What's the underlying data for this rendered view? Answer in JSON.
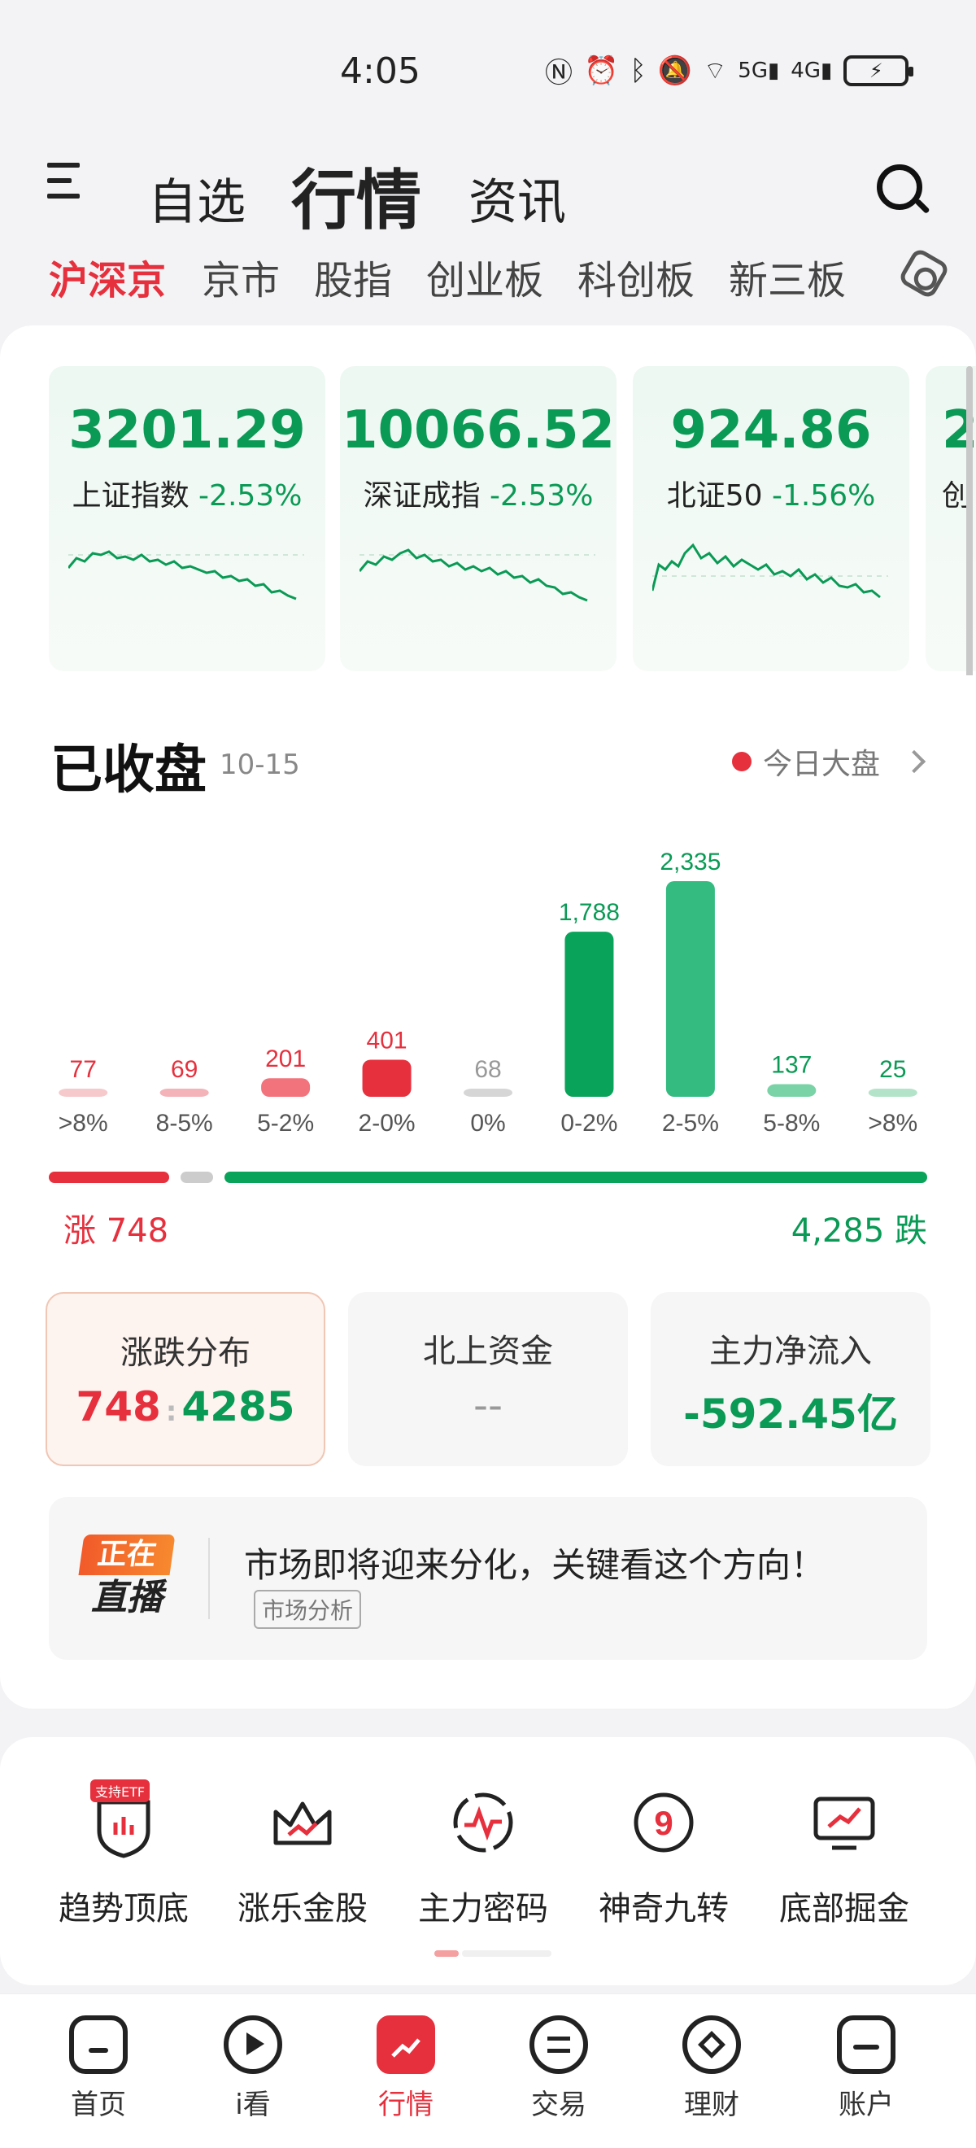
{
  "status_bar": {
    "time": "4:05",
    "icons": [
      "nfc-icon",
      "alarm-icon",
      "bluetooth-icon",
      "mute-icon",
      "wifi-icon",
      "5g-signal-icon",
      "4g-signal-icon",
      "battery-charging-icon"
    ]
  },
  "header": {
    "tabs": [
      "自选",
      "行情",
      "资讯"
    ],
    "active_tab": "行情"
  },
  "sub_tabs": [
    "沪深京",
    "京市",
    "股指",
    "创业板",
    "科创板",
    "新三板"
  ],
  "indices": [
    {
      "value": "3201.29",
      "name": "上证指数",
      "change": "-2.53%"
    },
    {
      "value": "10066.52",
      "name": "深证成指",
      "change": "-2.53%"
    },
    {
      "value": "924.86",
      "name": "北证50",
      "change": "-1.56%"
    },
    {
      "value": "2",
      "name": "创",
      "change": ""
    }
  ],
  "market": {
    "status": "已收盘",
    "date": "10-15",
    "today_link": "今日大盘"
  },
  "chart_data": {
    "type": "bar",
    "categories": [
      ">8%",
      "8-5%",
      "5-2%",
      "2-0%",
      "0%",
      "0-2%",
      "2-5%",
      "5-8%",
      ">8%"
    ],
    "values": [
      77,
      69,
      201,
      401,
      68,
      1788,
      2335,
      137,
      25
    ],
    "value_labels": [
      "77",
      "69",
      "201",
      "401",
      "68",
      "1,788",
      "2,335",
      "137",
      "25"
    ],
    "colors": [
      "#f6c9cc",
      "#f3b3b8",
      "#f2737c",
      "#e6303d",
      "#d6d6d6",
      "#0aa35a",
      "#33bb80",
      "#7ad3a6",
      "#b3e4c9"
    ],
    "label_colors": [
      "#e6303d",
      "#e6303d",
      "#e6303d",
      "#e6303d",
      "#999999",
      "#0a9a55",
      "#0a9a55",
      "#0a9a55",
      "#0a9a55"
    ],
    "ylim": [
      0,
      2335
    ]
  },
  "breadth": {
    "rise_label": "涨 748",
    "fall_label": "4,285 跌"
  },
  "stats": [
    {
      "title": "涨跌分布",
      "up": "748",
      "sep": ":",
      "down": "4285"
    },
    {
      "title": "北上资金",
      "value": "--"
    },
    {
      "title": "主力净流入",
      "value": "-592.45亿"
    }
  ],
  "live": {
    "badge_top": "正在",
    "badge_bottom": "直播",
    "title": "市场即将迎来分化，关键看这个方向！",
    "tag": "市场分析"
  },
  "tools": [
    {
      "label": "趋势顶底",
      "tag": "支持ETF"
    },
    {
      "label": "涨乐金股"
    },
    {
      "label": "主力密码"
    },
    {
      "label": "神奇九转"
    },
    {
      "label": "底部掘金"
    }
  ],
  "bottom_nav": [
    "首页",
    "i看",
    "行情",
    "交易",
    "理财",
    "账户"
  ],
  "colors": {
    "red": "#e6303d",
    "green": "#0a9a55"
  }
}
